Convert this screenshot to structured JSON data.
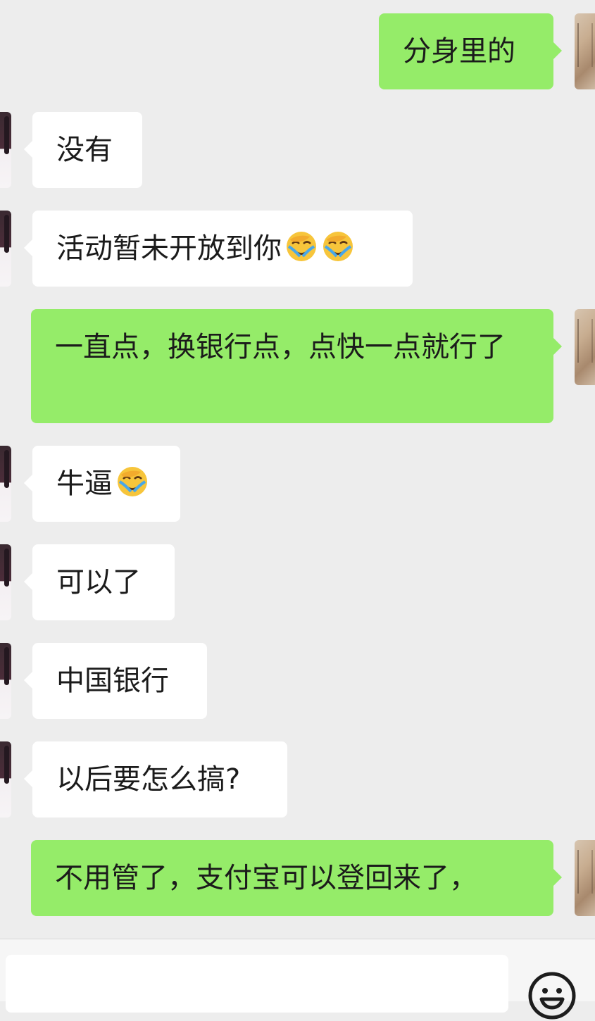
{
  "messages": [
    {
      "side": "out",
      "text": "分身里的",
      "emoji_count": 0
    },
    {
      "side": "in",
      "text": "没有",
      "emoji_count": 0
    },
    {
      "side": "in",
      "text": "活动暂未开放到你",
      "emoji_count": 2,
      "emoji": "face-palm-tears-emoji"
    },
    {
      "side": "out",
      "text": "一直点，换银行点，点快一点就行了",
      "emoji_count": 0
    },
    {
      "side": "in",
      "text": "牛逼",
      "emoji_count": 1,
      "emoji": "face-palm-tears-emoji"
    },
    {
      "side": "in",
      "text": "可以了",
      "emoji_count": 0
    },
    {
      "side": "in",
      "text": "中国银行",
      "emoji_count": 0
    },
    {
      "side": "in",
      "text": "以后要怎么搞?",
      "emoji_count": 0
    },
    {
      "side": "out",
      "text": "不用管了，支付宝可以登回来了，",
      "emoji_count": 0
    }
  ],
  "input": {
    "placeholder": ""
  },
  "icons": {
    "emoji_button": "smiley-face-icon"
  },
  "colors": {
    "background": "#ededed",
    "incoming_bubble": "#ffffff",
    "outgoing_bubble": "#95ec69",
    "text": "#1b1b1b"
  }
}
